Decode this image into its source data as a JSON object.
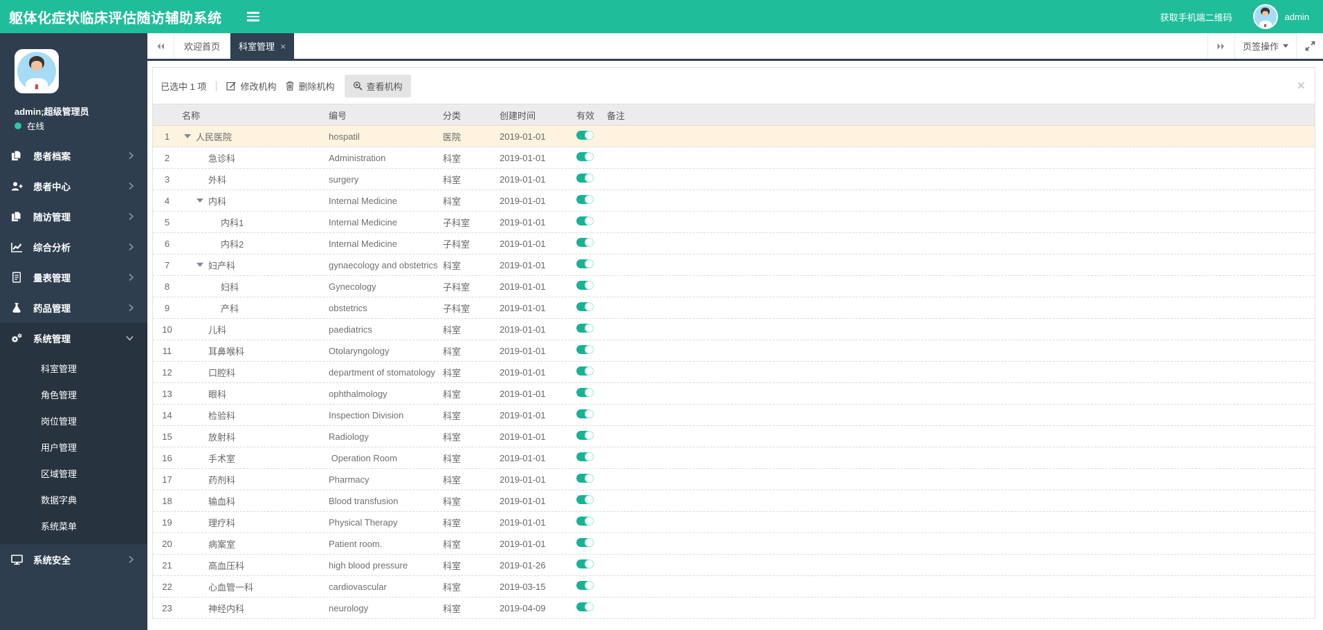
{
  "app": {
    "title": "躯体化症状临床评估随访辅助系统",
    "qr_link": "获取手机端二维码",
    "username": "admin"
  },
  "colors": {
    "accent": "#1ab394",
    "topbar_bg": "#20bd9b",
    "sidebar_bg": "#2e3e4e",
    "sidebar_submenu_bg": "#27333f",
    "tab_active_bg": "#2f4050",
    "selected_row_bg": "#fdf3df",
    "toggle_on": "#18b294"
  },
  "sidebar": {
    "user": {
      "name": "admin;超级管理员",
      "status": "在线"
    },
    "items": [
      {
        "label": "患者档案",
        "icon": "files-icon",
        "chevron": "right"
      },
      {
        "label": "患者中心",
        "icon": "user-plus-icon",
        "chevron": "right"
      },
      {
        "label": "随访管理",
        "icon": "files-icon",
        "chevron": "right"
      },
      {
        "label": "综合分析",
        "icon": "line-chart-icon",
        "chevron": "right"
      },
      {
        "label": "量表管理",
        "icon": "file-text-icon",
        "chevron": "right"
      },
      {
        "label": "药品管理",
        "icon": "flask-icon",
        "chevron": "right"
      },
      {
        "label": "系统管理",
        "icon": "gears-icon",
        "chevron": "down",
        "expanded": true,
        "children": [
          "科室管理",
          "角色管理",
          "岗位管理",
          "用户管理",
          "区域管理",
          "数据字典",
          "系统菜单"
        ]
      },
      {
        "label": "系统安全",
        "icon": "desktop-icon",
        "chevron": "right"
      }
    ]
  },
  "tabbar": {
    "tabs": [
      {
        "label": "欢迎首页",
        "active": false,
        "closable": false
      },
      {
        "label": "科室管理",
        "active": true,
        "closable": true
      }
    ],
    "ops_label": "页签操作"
  },
  "toolbar": {
    "selected_text": "已选中 1 项",
    "edit_label": "修改机构",
    "delete_label": "删除机构",
    "view_label": "查看机构"
  },
  "table": {
    "columns": [
      "名称",
      "编号",
      "分类",
      "创建时间",
      "有效",
      "备注"
    ],
    "rows": [
      {
        "num": 1,
        "name": "人民医院",
        "level": 1,
        "expandable": true,
        "code": "hospatil",
        "category": "医院",
        "created": "2019-01-01",
        "valid": true,
        "selected": true
      },
      {
        "num": 2,
        "name": "急诊科",
        "level": 2,
        "expandable": false,
        "code": "Administration",
        "category": "科室",
        "created": "2019-01-01",
        "valid": true
      },
      {
        "num": 3,
        "name": "外科",
        "level": 2,
        "expandable": false,
        "code": "surgery",
        "category": "科室",
        "created": "2019-01-01",
        "valid": true
      },
      {
        "num": 4,
        "name": "内科",
        "level": 2,
        "expandable": true,
        "code": "Internal Medicine",
        "category": "科室",
        "created": "2019-01-01",
        "valid": true
      },
      {
        "num": 5,
        "name": "内科1",
        "level": 3,
        "expandable": false,
        "code": "Internal Medicine",
        "category": "子科室",
        "created": "2019-01-01",
        "valid": true
      },
      {
        "num": 6,
        "name": "内科2",
        "level": 3,
        "expandable": false,
        "code": "Internal Medicine",
        "category": "子科室",
        "created": "2019-01-01",
        "valid": true
      },
      {
        "num": 7,
        "name": "妇产科",
        "level": 2,
        "expandable": true,
        "code": "gynaecology and obstetrics",
        "category": "科室",
        "created": "2019-01-01",
        "valid": true
      },
      {
        "num": 8,
        "name": "妇科",
        "level": 3,
        "expandable": false,
        "code": "Gynecology",
        "category": "子科室",
        "created": "2019-01-01",
        "valid": true
      },
      {
        "num": 9,
        "name": "产科",
        "level": 3,
        "expandable": false,
        "code": "obstetrics",
        "category": "子科室",
        "created": "2019-01-01",
        "valid": true
      },
      {
        "num": 10,
        "name": "儿科",
        "level": 2,
        "expandable": false,
        "code": "paediatrics",
        "category": "科室",
        "created": "2019-01-01",
        "valid": true
      },
      {
        "num": 11,
        "name": "耳鼻喉科",
        "level": 2,
        "expandable": false,
        "code": "Otolaryngology",
        "category": "科室",
        "created": "2019-01-01",
        "valid": true
      },
      {
        "num": 12,
        "name": "口腔科",
        "level": 2,
        "expandable": false,
        "code": "department of stomatology",
        "category": "科室",
        "created": "2019-01-01",
        "valid": true
      },
      {
        "num": 13,
        "name": "眼科",
        "level": 2,
        "expandable": false,
        "code": "ophthalmology",
        "category": "科室",
        "created": "2019-01-01",
        "valid": true
      },
      {
        "num": 14,
        "name": "检验科",
        "level": 2,
        "expandable": false,
        "code": "Inspection Division",
        "category": "科室",
        "created": "2019-01-01",
        "valid": true
      },
      {
        "num": 15,
        "name": "放射科",
        "level": 2,
        "expandable": false,
        "code": "Radiology",
        "category": "科室",
        "created": "2019-01-01",
        "valid": true
      },
      {
        "num": 16,
        "name": "手术室",
        "level": 2,
        "expandable": false,
        "code": " Operation Room",
        "category": "科室",
        "created": "2019-01-01",
        "valid": true
      },
      {
        "num": 17,
        "name": "药剂科",
        "level": 2,
        "expandable": false,
        "code": "Pharmacy",
        "category": "科室",
        "created": "2019-01-01",
        "valid": true
      },
      {
        "num": 18,
        "name": "输血科",
        "level": 2,
        "expandable": false,
        "code": "Blood transfusion",
        "category": "科室",
        "created": "2019-01-01",
        "valid": true
      },
      {
        "num": 19,
        "name": "理疗科",
        "level": 2,
        "expandable": false,
        "code": "Physical Therapy",
        "category": "科室",
        "created": "2019-01-01",
        "valid": true
      },
      {
        "num": 20,
        "name": "病案室",
        "level": 2,
        "expandable": false,
        "code": "Patient room.",
        "category": "科室",
        "created": "2019-01-01",
        "valid": true
      },
      {
        "num": 21,
        "name": "高血压科",
        "level": 2,
        "expandable": false,
        "code": "high blood pressure",
        "category": "科室",
        "created": "2019-01-26",
        "valid": true
      },
      {
        "num": 22,
        "name": "心血管一科",
        "level": 2,
        "expandable": false,
        "code": "cardiovascular",
        "category": "科室",
        "created": "2019-03-15",
        "valid": true
      },
      {
        "num": 23,
        "name": "神经内科",
        "level": 2,
        "expandable": false,
        "code": "neurology",
        "category": "科室",
        "created": "2019-04-09",
        "valid": true
      }
    ]
  }
}
